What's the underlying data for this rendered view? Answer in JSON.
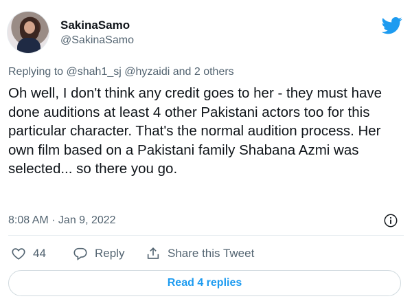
{
  "user": {
    "display_name": "SakinaSamo",
    "handle": "@SakinaSamo"
  },
  "reply_context": {
    "prefix": "Replying to",
    "mentions": "@shah1_sj @hyzaidi and 2 others"
  },
  "tweet": {
    "text": "Oh well, I don't think any credit goes to her - they must have done auditions at least 4 other Pakistani actors too for this particular character. That's the normal audition process.  Her own film based on a Pakistani family Shabana Azmi was selected... so there you go.",
    "timestamp": "8:08 AM · Jan 9, 2022"
  },
  "actions": {
    "like_count": "44",
    "reply_label": "Reply",
    "share_label": "Share this Tweet"
  },
  "read_replies_label": "Read 4 replies",
  "icons": {
    "logo": "twitter-bird-icon",
    "info": "info-icon",
    "like": "heart-icon",
    "reply": "speech-bubble-icon",
    "share": "share-icon"
  },
  "colors": {
    "brand": "#1d9bf0",
    "secondary_text": "#536471",
    "primary_text": "#0f1419",
    "border": "#cfd9de"
  }
}
